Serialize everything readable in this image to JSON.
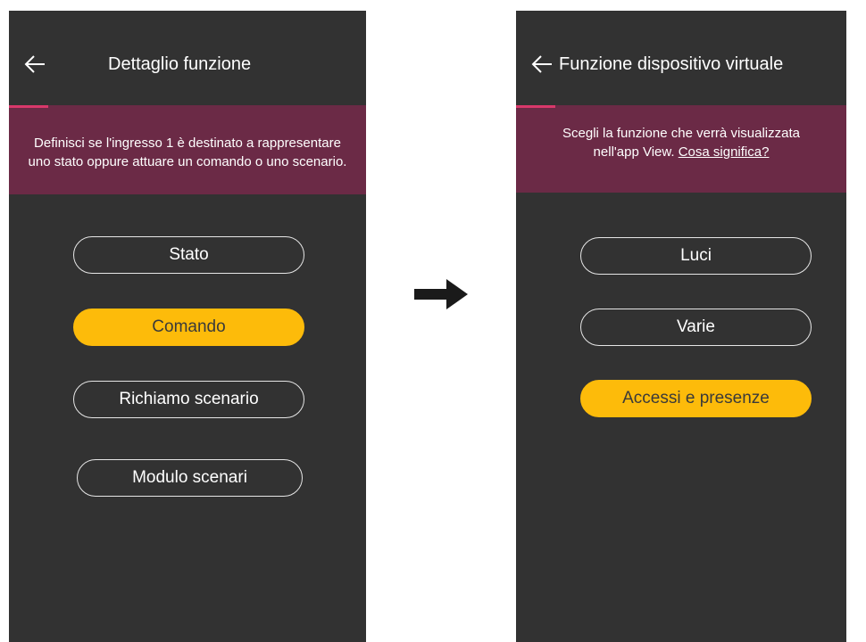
{
  "left_screen": {
    "title": "Dettaglio funzione",
    "banner_text": "Definisci se l'ingresso 1 è destinato a rappresentare uno stato oppure attuare un comando o uno scenario.",
    "options": [
      {
        "label": "Stato",
        "selected": false
      },
      {
        "label": "Comando",
        "selected": true
      },
      {
        "label": "Richiamo scenario",
        "selected": false
      },
      {
        "label": "Modulo scenari",
        "selected": false
      }
    ]
  },
  "right_screen": {
    "title": "Funzione dispositivo virtuale",
    "banner_text_1": "Scegli la funzione che verrà visualizzata",
    "banner_text_2": "nell'app View.",
    "banner_link": "Cosa significa?",
    "options": [
      {
        "label": "Luci",
        "selected": false
      },
      {
        "label": "Varie",
        "selected": false
      },
      {
        "label": "Accessi e presenze",
        "selected": true
      }
    ]
  },
  "colors": {
    "screen_bg": "#323232",
    "banner_bg": "#6b2a46",
    "accent": "#d9386a",
    "selected_button": "#fdbb0a"
  },
  "icons": [
    "back-arrow-icon",
    "right-arrow-icon"
  ]
}
